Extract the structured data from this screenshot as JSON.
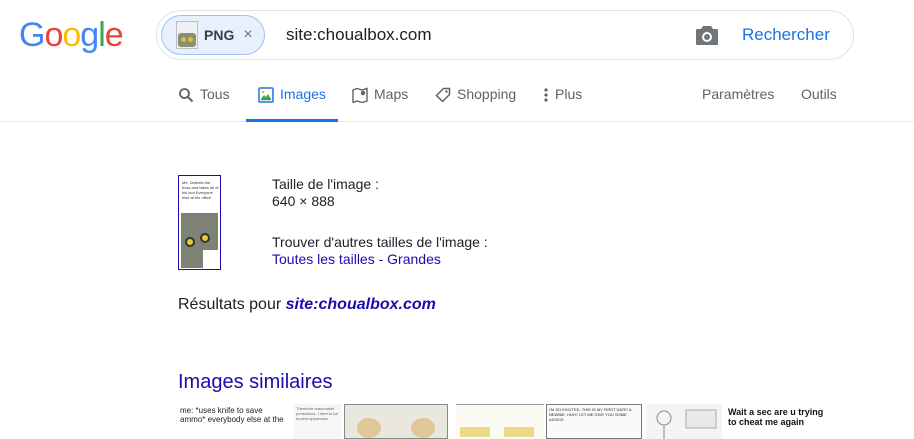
{
  "logo": {
    "letters": [
      "G",
      "o",
      "o",
      "g",
      "l",
      "e"
    ]
  },
  "search": {
    "chip_label": "PNG",
    "chip_close": "×",
    "query": "site:choualbox.com",
    "submit_label": "Rechercher"
  },
  "tabs": {
    "all": "Tous",
    "images": "Images",
    "maps": "Maps",
    "shopping": "Shopping",
    "more": "Plus",
    "settings": "Paramètres",
    "tools": "Outils"
  },
  "image_info": {
    "thumb_text": "Me: Defeats the boss and takes all of his loot  Everyone else at the office",
    "size_label": "Taille de l'image :",
    "size_value": "640 × 888",
    "other_sizes_label": "Trouver d'autres tailles de l'image :",
    "all_sizes": "Toutes les tailles",
    "separator": " - ",
    "large": "Grandes"
  },
  "results": {
    "prefix": "Résultats pour ",
    "query": "site:choualbox.com"
  },
  "similar": {
    "title": "Images similaires",
    "item1_text": "me: *uses knife to save ammo*  everybody else at the",
    "item2_text": "Therefore reasonable predictions, I here to be honest appreciate",
    "item5_text": "I'M SO EXCITED, THIS IS MY FIRST DATE!   A NEWBIE, HUH? LET ME GIVE YOU SOME ADVICE",
    "item7_text": "Wait a sec are u trying to cheat me again"
  },
  "colors": {
    "accent": "#1a73e8",
    "link": "#1a0dab",
    "text": "#202124",
    "muted": "#5f6368"
  }
}
